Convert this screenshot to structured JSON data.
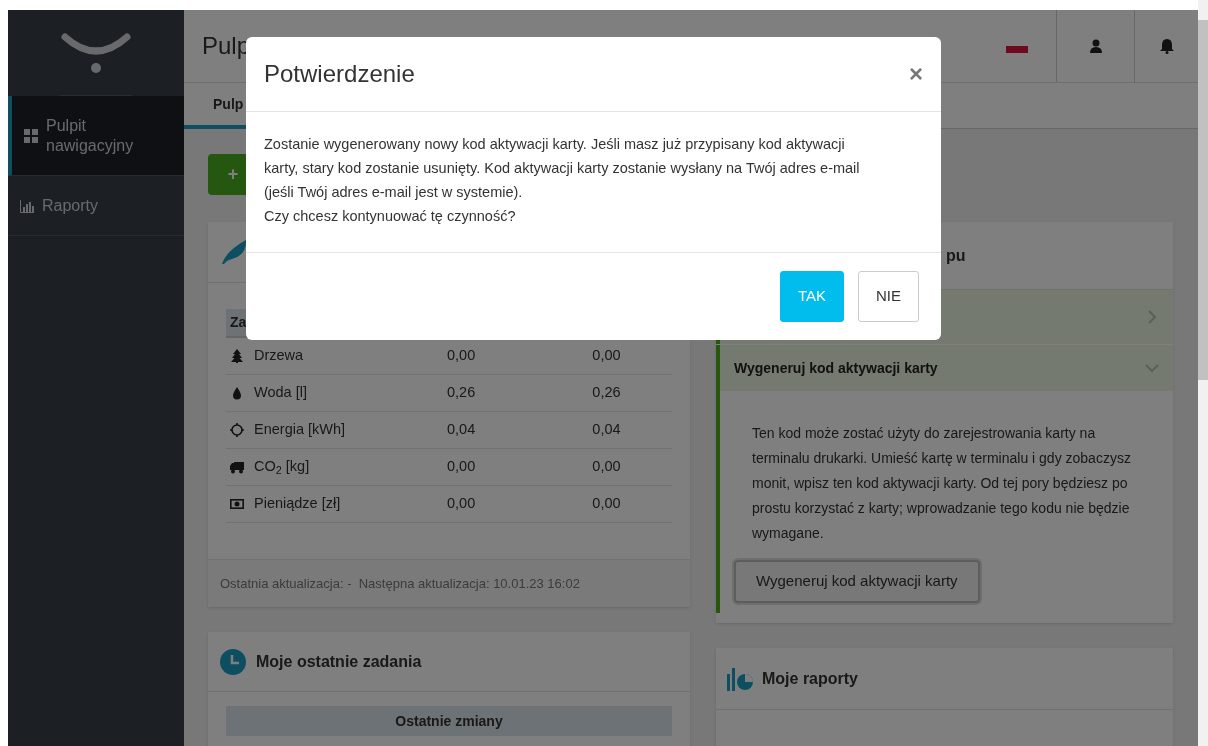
{
  "sidebar": {
    "items": [
      {
        "label": "Pulpit nawigacyjny",
        "selected": true
      },
      {
        "label": "Raporty",
        "selected": false
      }
    ]
  },
  "header": {
    "title": "Pulp"
  },
  "tabs": [
    {
      "label": "Pulp",
      "selected": true
    }
  ],
  "add_button": {
    "label": "+"
  },
  "impact_card": {
    "columns": [
      "Za"
    ],
    "rows": [
      {
        "label": "Drzewa",
        "values": [
          "0,00",
          "0,00"
        ]
      },
      {
        "label": "Woda [l]",
        "values": [
          "0,26",
          "0,26"
        ]
      },
      {
        "label": "Energia [kWh]",
        "values": [
          "0,04",
          "0,04"
        ]
      },
      {
        "label": "CO$_{2}$ [kg]",
        "values": [
          "0,00",
          "0,00"
        ]
      },
      {
        "label": "Pieniądze [zł]",
        "values": [
          "0,00",
          "0,00"
        ]
      }
    ],
    "footer": "Ostatnia aktualizacja: -  Następna aktualizacja: 10.01.23 16:02"
  },
  "access_card": {
    "title": "pu",
    "items": [
      {
        "expanded": false
      },
      {
        "title": "Wygeneruj kod aktywacji karty",
        "expanded": true,
        "text": "Ten kod może zostać użyty do zarejestrowania karty na terminalu drukarki. Umieść kartę w terminalu i gdy zobaczysz monit, wpisz ten kod aktywacji karty. Od tej pory będziesz po prostu korzystać z karty; wprowadzanie tego kodu nie będzie wymagane.",
        "button": "Wygeneruj kod aktywacji karty"
      }
    ]
  },
  "recent_tasks": {
    "title": "Moje ostatnie zadania",
    "table_header": "Ostatnie zmiany"
  },
  "reports": {
    "title": "Moje raporty"
  },
  "dialog": {
    "title": "Potwierdzenie",
    "close": "×",
    "paragraphs": [
      "Zostanie wygenerowany nowy kod aktywacji karty. Jeśli masz już przypisany kod aktywacji karty, stary kod zostanie usunięty. Kod aktywacji karty zostanie wysłany na Twój adres e-mail (jeśli Twój adres e-mail jest w systemie).",
      "Czy chcesz kontynuować tę czynność?"
    ],
    "buttons": [
      {
        "label": "TAK",
        "kind": "primary"
      },
      {
        "label": "NIE",
        "kind": "default"
      }
    ]
  }
}
